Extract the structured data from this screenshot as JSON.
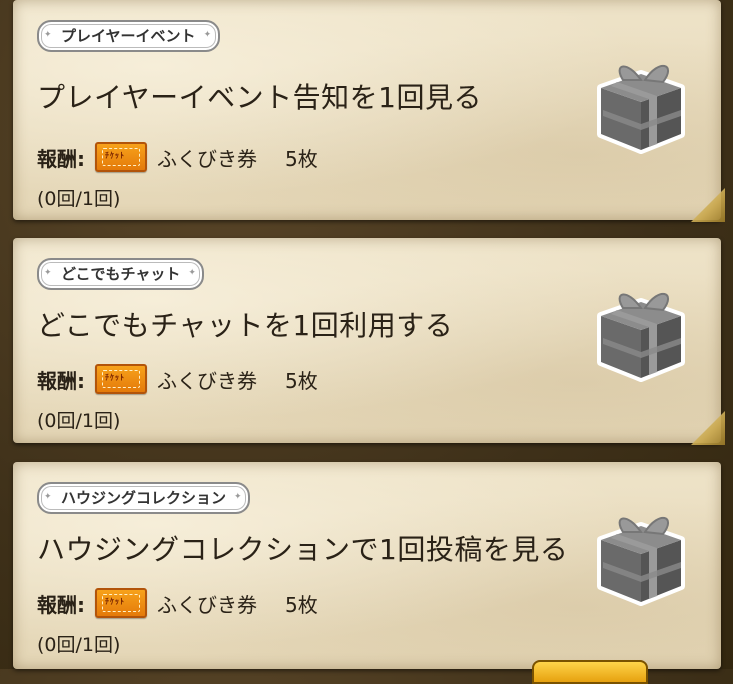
{
  "missions": [
    {
      "tag": "プレイヤーイベント",
      "title": "プレイヤーイベント告知を1回見る",
      "reward_label": "報酬:",
      "reward_item": "ふくびき券",
      "reward_count": "5枚",
      "progress": "(0回/1回)",
      "ticket_icon": "fukubiki-ticket-icon",
      "gift_icon": "gift-box-icon"
    },
    {
      "tag": "どこでもチャット",
      "title": "どこでもチャットを1回利用する",
      "reward_label": "報酬:",
      "reward_item": "ふくびき券",
      "reward_count": "5枚",
      "progress": "(0回/1回)",
      "ticket_icon": "fukubiki-ticket-icon",
      "gift_icon": "gift-box-icon"
    },
    {
      "tag": "ハウジングコレクション",
      "title": "ハウジングコレクションで1回投稿を見る",
      "reward_label": "報酬:",
      "reward_item": "ふくびき券",
      "reward_count": "5枚",
      "progress": "(0回/1回)",
      "ticket_icon": "fukubiki-ticket-icon",
      "gift_icon": "gift-box-icon"
    }
  ],
  "colors": {
    "parchment": "#e8dcbf",
    "text": "#2a2217",
    "ticket": "#f7a21b",
    "gift": "#7a7a7a"
  }
}
